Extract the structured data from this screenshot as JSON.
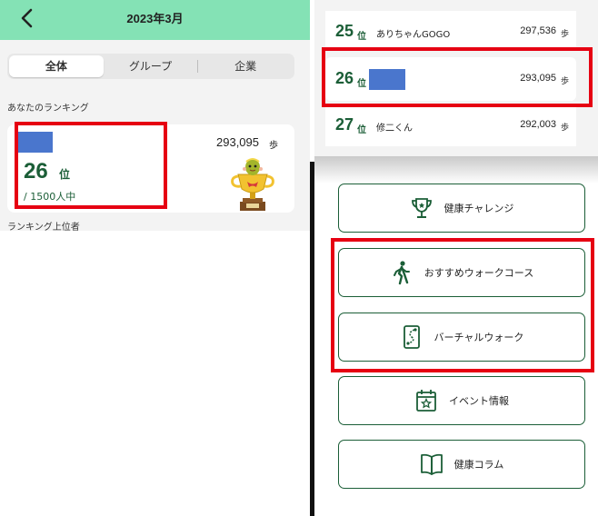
{
  "ranking_screen": {
    "header": {
      "title": "2023年3月"
    },
    "tabs": [
      {
        "label": "全体",
        "active": true
      },
      {
        "label": "グループ",
        "active": false
      },
      {
        "label": "企業",
        "active": false
      }
    ],
    "your_ranking_label": "あなたのランキング",
    "my_rank": {
      "rank": "26",
      "rank_unit": "位",
      "total": "/ 1500人中",
      "steps": "293,095",
      "steps_unit": "歩"
    },
    "top_rankers_label": "ランキング上位者"
  },
  "ranking_list": [
    {
      "rank": "25",
      "unit": "位",
      "name": "ありちゃんGOGO",
      "steps": "297,536",
      "steps_unit": "歩"
    },
    {
      "rank": "26",
      "unit": "位",
      "name": "",
      "steps": "293,095",
      "steps_unit": "歩"
    },
    {
      "rank": "27",
      "unit": "位",
      "name": "修二くん",
      "steps": "292,003",
      "steps_unit": "歩"
    }
  ],
  "menu": [
    {
      "label": "健康チャレンジ",
      "icon": "trophy-icon"
    },
    {
      "label": "おすすめウォークコース",
      "icon": "walking-person-icon"
    },
    {
      "label": "バーチャルウォーク",
      "icon": "smartphone-route-icon"
    },
    {
      "label": "イベント情報",
      "icon": "calendar-star-icon"
    },
    {
      "label": "健康コラム",
      "icon": "open-book-icon"
    }
  ],
  "colors": {
    "header_green": "#84e2b5",
    "dark_green": "#1b5e37",
    "highlight_red": "#e60012",
    "redaction_blue": "#4a76cd"
  }
}
